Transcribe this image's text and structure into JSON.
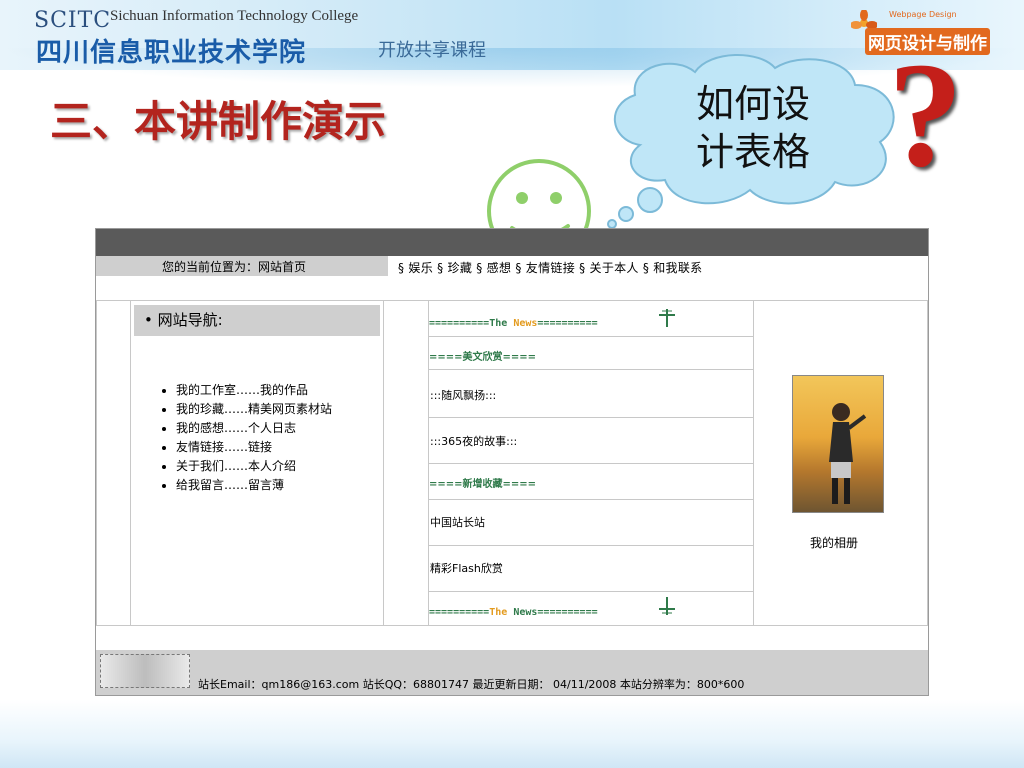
{
  "header": {
    "org_abbr": "SCITC",
    "college_en": "Sichuan Information Technology College",
    "college_cn": "四川信息职业技术学院",
    "course_tag": "开放共享课程",
    "badge_cn": "网页设计与制作",
    "badge_en": "Webpage Design"
  },
  "slide": {
    "title": "三、本讲制作演示",
    "bubble_text": "如何设计表格",
    "question_mark": "?"
  },
  "webpage": {
    "location": "您的当前位置为：网站首页",
    "nav": "§ 娱乐 § 珍藏 § 感想 § 友情链接 § 关于本人 § 和我联系",
    "sidebar": {
      "heading": "• 网站导航:",
      "items": [
        "我的工作室……我的作品",
        "我的珍藏……精美网页素材站",
        "我的感想……个人日志",
        "友情链接……链接",
        "关于我们……本人介绍",
        "给我留言……留言薄"
      ]
    },
    "news_banner": {
      "left": "==========",
      "the": "The",
      "news": "News",
      "right": "=========="
    },
    "section1": "====美文欣赏====",
    "item1": ":::随风飘扬:::",
    "item2": ":::365夜的故事:::",
    "section2": "====新增收藏====",
    "item3": "中国站长站",
    "item4": "精彩Flash欣赏",
    "album_label": "我的相册",
    "footer": "站长Email：qm186@163.com   站长QQ：68801747  最近更新日期： 04/11/2008  本站分辨率为：800*600"
  },
  "colors": {
    "title_red": "#b3241e",
    "question_red": "#c41f1a",
    "news_green": "#2f7a4a",
    "news_orange": "#e39b1f",
    "dark_bar": "#5a5a5a",
    "gray_bar": "#cfcfcf"
  }
}
